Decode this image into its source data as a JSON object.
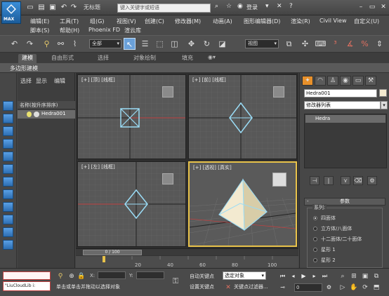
{
  "title_bar": {
    "logo_text": "MAX",
    "doc_title": "无标题",
    "search_placeholder": "键入关键字或短语",
    "login": "登录"
  },
  "menu": {
    "row1": [
      "编辑(E)",
      "工具(T)",
      "组(G)",
      "视图(V)",
      "创建(C)",
      "修改器(M)",
      "动画(A)",
      "图形编辑器(D)",
      "渲染(R)",
      "Civil View",
      "自定义(U)"
    ],
    "row2": [
      "脚本(S)",
      "帮助(H)",
      "Phoenix FD",
      "渲云库"
    ]
  },
  "toolbar": {
    "selection_filter": "全部",
    "reference_coord": "视图"
  },
  "ribbon": {
    "tabs": [
      "建模",
      "自由形式",
      "选择",
      "对象绘制",
      "填充"
    ],
    "active_tab": "建模",
    "subpanel": "多边形建模"
  },
  "scene_explorer": {
    "tabs": [
      "选择",
      "显示",
      "编辑"
    ],
    "header": "名称(按升序排序)",
    "object": "Hedra001"
  },
  "viewports": [
    {
      "label": "[+] [顶] [线框]"
    },
    {
      "label": "[+] [前] [线框]"
    },
    {
      "label": "[+] [左] [线框]"
    },
    {
      "label": "[+] [透视] [真实]"
    }
  ],
  "command_panel": {
    "object_name": "Hedra001",
    "modifier_list": "修改器列表",
    "stack_item": "Hedra",
    "rollout_title": "参数",
    "group_label": "系列:",
    "family_options": [
      "四面体",
      "立方体/八面体",
      "十二面体/二十面体",
      "星形 1",
      "星形 2"
    ],
    "family_selected": 0
  },
  "timeline": {
    "slider_label": "0 / 100",
    "ticks": [
      "20",
      "40",
      "60",
      "80",
      "100"
    ]
  },
  "status": {
    "maxscript": "\"LiuCloudLib i:",
    "prompt": "单击或单击并拖动以选择对象",
    "x_label": "X:",
    "y_label": "Y:",
    "auto_key": "自动关键点",
    "set_key": "设置关键点",
    "selected_object": "选定对象",
    "key_filters": "关键点过滤器...",
    "frame": "0"
  },
  "colors": {
    "accent": "#e8c24a",
    "active_tool": "#6aa0d8",
    "gizmo": "#7ad0f0",
    "pyramid": "#f3ead0"
  }
}
